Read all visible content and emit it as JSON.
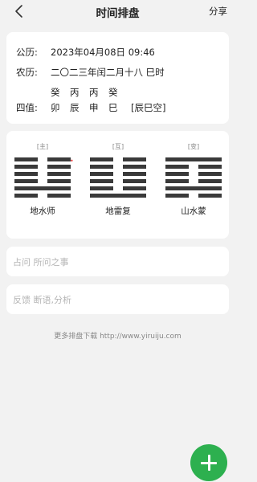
{
  "header": {
    "title": "时间排盘",
    "share_label": "分享",
    "back_icon": "chevron-left-icon"
  },
  "info": {
    "solar_label": "公历:",
    "solar_value": "2023年04月08日 09:46",
    "lunar_label": "农历:",
    "lunar_value": "二〇二三年闰二月十八 巳时",
    "pillars_label": "四值:",
    "stems": [
      "癸",
      "丙",
      "丙",
      "癸"
    ],
    "branches": [
      "卯",
      "辰",
      "申",
      "巳"
    ],
    "kongwang": "[辰巳空]"
  },
  "hexagrams": [
    {
      "tag": "[主]",
      "name": "地水师",
      "lines_top_to_bottom": [
        "yin",
        "yin",
        "yin",
        "yin",
        "yang",
        "yin"
      ],
      "moving_mark": "•"
    },
    {
      "tag": "[互]",
      "name": "地雷复",
      "lines_top_to_bottom": [
        "yin",
        "yin",
        "yin",
        "yin",
        "yin",
        "yang"
      ]
    },
    {
      "tag": "[变]",
      "name": "山水蒙",
      "lines_top_to_bottom": [
        "yang",
        "yin",
        "yin",
        "yin",
        "yang",
        "yin"
      ]
    }
  ],
  "question_placeholder": "占问 所问之事",
  "feedback_placeholder": "反馈 断语,分析",
  "footer_text": "更多排盘下载 http://www.yiruiju.com",
  "fab": {
    "icon": "plus-icon",
    "color": "#2db04f"
  }
}
